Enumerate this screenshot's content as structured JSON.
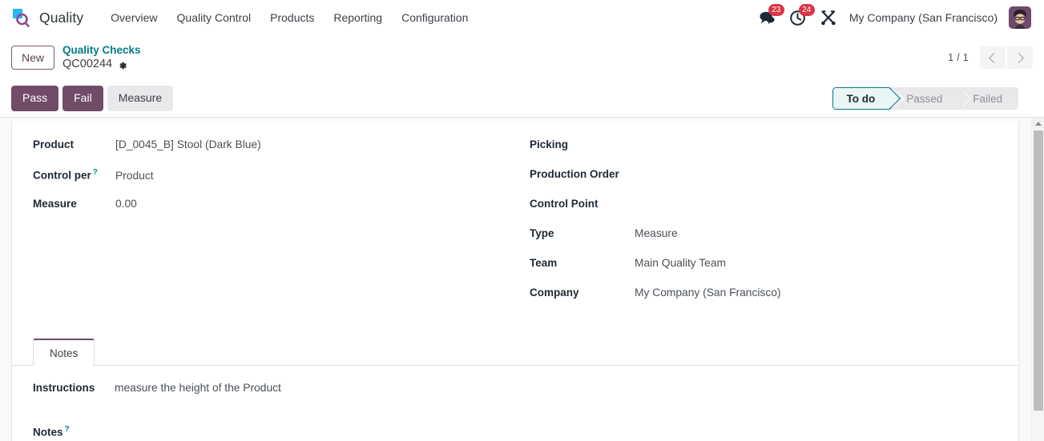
{
  "navbar": {
    "brand": "Quality",
    "brand_logo_icon": "quality-magnifier-logo",
    "menu": [
      {
        "label": "Overview"
      },
      {
        "label": "Quality Control"
      },
      {
        "label": "Products"
      },
      {
        "label": "Reporting"
      },
      {
        "label": "Configuration"
      }
    ],
    "messages_icon": "chat-bubble-icon",
    "messages_count": "23",
    "activities_icon": "clock-icon",
    "activities_count": "24",
    "debug_icon": "wrench-tools-icon",
    "company": "My Company (San Francisco)",
    "avatar_icon": "user-avatar"
  },
  "breadcrumb": {
    "new_label": "New",
    "parent": "Quality Checks",
    "current": "QC00244",
    "settings_icon": "gear-icon"
  },
  "pager": {
    "count": "1 / 1",
    "prev_icon": "chevron-left-icon",
    "next_icon": "chevron-right-icon"
  },
  "actions": {
    "pass_label": "Pass",
    "fail_label": "Fail",
    "measure_label": "Measure"
  },
  "statusbar": {
    "stages": [
      {
        "label": "To do",
        "active": true
      },
      {
        "label": "Passed",
        "active": false
      },
      {
        "label": "Failed",
        "active": false
      }
    ],
    "active_color": "#017e84",
    "active_bg": "#eaf5f5"
  },
  "form": {
    "left_fields": [
      {
        "label": "Product",
        "value": "[D_0045_B] Stool (Dark Blue)",
        "help": false
      },
      {
        "label": "Control per",
        "value": "Product",
        "help": true
      },
      {
        "label": "Measure",
        "value": "0.00",
        "help": false
      }
    ],
    "right_fields": [
      {
        "label": "Picking",
        "value": "",
        "help": false
      },
      {
        "label": "Production Order",
        "value": "",
        "help": false
      },
      {
        "label": "Control Point",
        "value": "",
        "help": false
      },
      {
        "label": "Type",
        "value": "Measure",
        "help": false
      },
      {
        "label": "Team",
        "value": "Main Quality Team",
        "help": false
      },
      {
        "label": "Company",
        "value": "My Company (San Francisco)",
        "help": false
      }
    ]
  },
  "notebook": {
    "tabs": [
      {
        "label": "Notes",
        "active": true
      }
    ],
    "instructions_label": "Instructions",
    "instructions_value": "measure the height of the Product",
    "notes_label": "Notes",
    "notes_help": "?"
  },
  "theme": {
    "primary": "#714b67",
    "link": "#017e84",
    "badge": "#dc3545"
  }
}
